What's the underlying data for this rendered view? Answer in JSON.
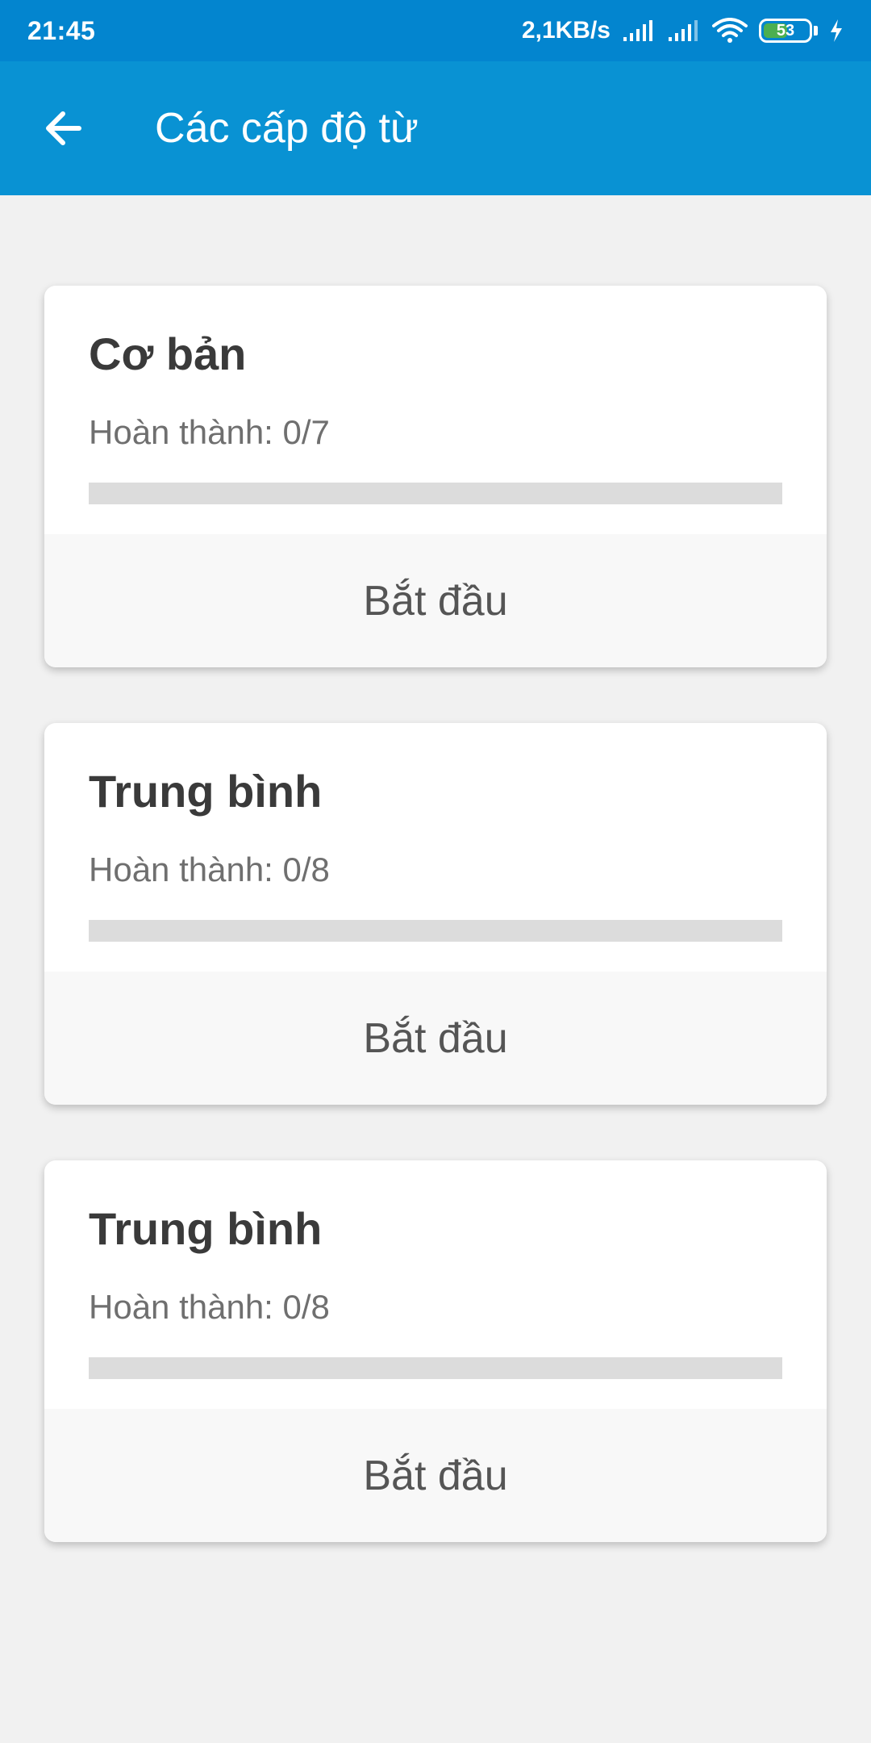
{
  "status_bar": {
    "time": "21:45",
    "net_speed": "2,1KB/s",
    "battery_level": "53",
    "icons": [
      "signal-icon",
      "signal-icon",
      "wifi-icon",
      "battery-icon",
      "charging-icon"
    ]
  },
  "app_bar": {
    "title": "Các cấp độ từ",
    "back_icon": "arrow-back-icon"
  },
  "colors": {
    "status_bar_bg": "#0385cf",
    "app_bar_bg": "#0992d3",
    "page_bg": "#f1f1f1",
    "progress_track": "#dcdcdc"
  },
  "levels": [
    {
      "title": "Cơ bản",
      "progress_text": "Hoàn thành: 0/7",
      "progress": 0,
      "button_label": "Bắt đầu"
    },
    {
      "title": "Trung bình",
      "progress_text": "Hoàn thành: 0/8",
      "progress": 0,
      "button_label": "Bắt đầu"
    },
    {
      "title": "Trung bình",
      "progress_text": "Hoàn thành: 0/8",
      "progress": 0,
      "button_label": "Bắt đầu"
    }
  ]
}
